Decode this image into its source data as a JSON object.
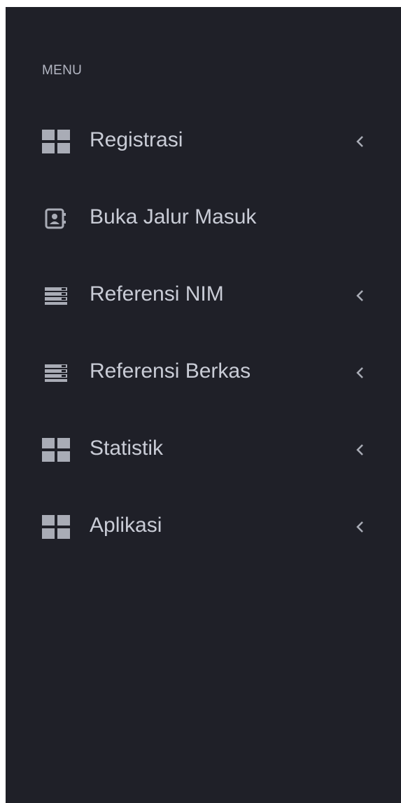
{
  "sidebar": {
    "menu_title": "MENU",
    "items": [
      {
        "label": "Registrasi",
        "icon": "grid-icon",
        "has_submenu": true
      },
      {
        "label": "Buka Jalur Masuk",
        "icon": "contact-card-icon",
        "has_submenu": false
      },
      {
        "label": "Referensi NIM",
        "icon": "list-icon",
        "has_submenu": true
      },
      {
        "label": "Referensi Berkas",
        "icon": "list-icon",
        "has_submenu": true
      },
      {
        "label": "Statistik",
        "icon": "grid-icon",
        "has_submenu": true
      },
      {
        "label": "Aplikasi",
        "icon": "grid-icon",
        "has_submenu": true
      }
    ]
  },
  "colors": {
    "sidebar_bg": "#1f2028",
    "text": "#c9ccd6",
    "heading": "#b3b6c2",
    "icon": "#a9acb6"
  }
}
